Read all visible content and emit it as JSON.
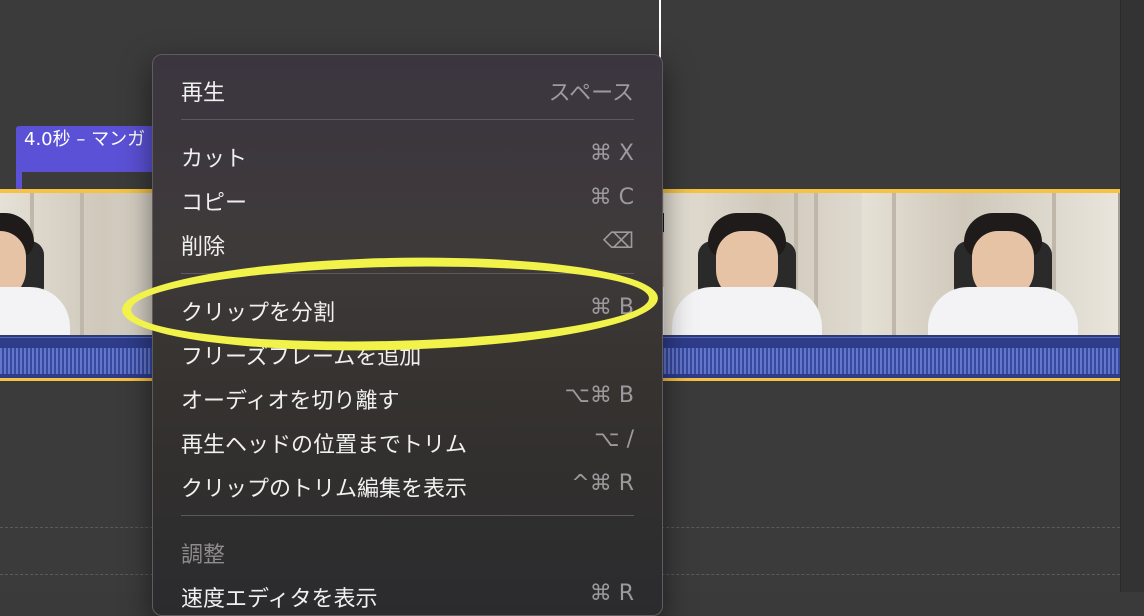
{
  "timeline": {
    "title_clip_label": "4.0秒 – マンガ"
  },
  "context_menu": {
    "items": [
      {
        "label": "再生",
        "shortcut": "スペース"
      },
      {
        "label": "カット",
        "shortcut": "⌘ X"
      },
      {
        "label": "コピー",
        "shortcut": "⌘ C"
      },
      {
        "label": "削除",
        "shortcut": "⌫"
      },
      {
        "label": "クリップを分割",
        "shortcut": "⌘ B"
      },
      {
        "label": "フリーズフレームを追加",
        "shortcut": ""
      },
      {
        "label": "オーディオを切り離す",
        "shortcut": "⌥⌘ B"
      },
      {
        "label": "再生ヘッドの位置までトリム",
        "shortcut": "⌥ /"
      },
      {
        "label": "クリップのトリム編集を表示",
        "shortcut": "^⌘ R"
      },
      {
        "label": "調整",
        "shortcut": ""
      },
      {
        "label": "速度エディタを表示",
        "shortcut": "⌘ R"
      }
    ]
  },
  "colors": {
    "highlight": "#f1f24a",
    "clip_border": "#f5c242",
    "title_flag": "#5b51d6"
  }
}
